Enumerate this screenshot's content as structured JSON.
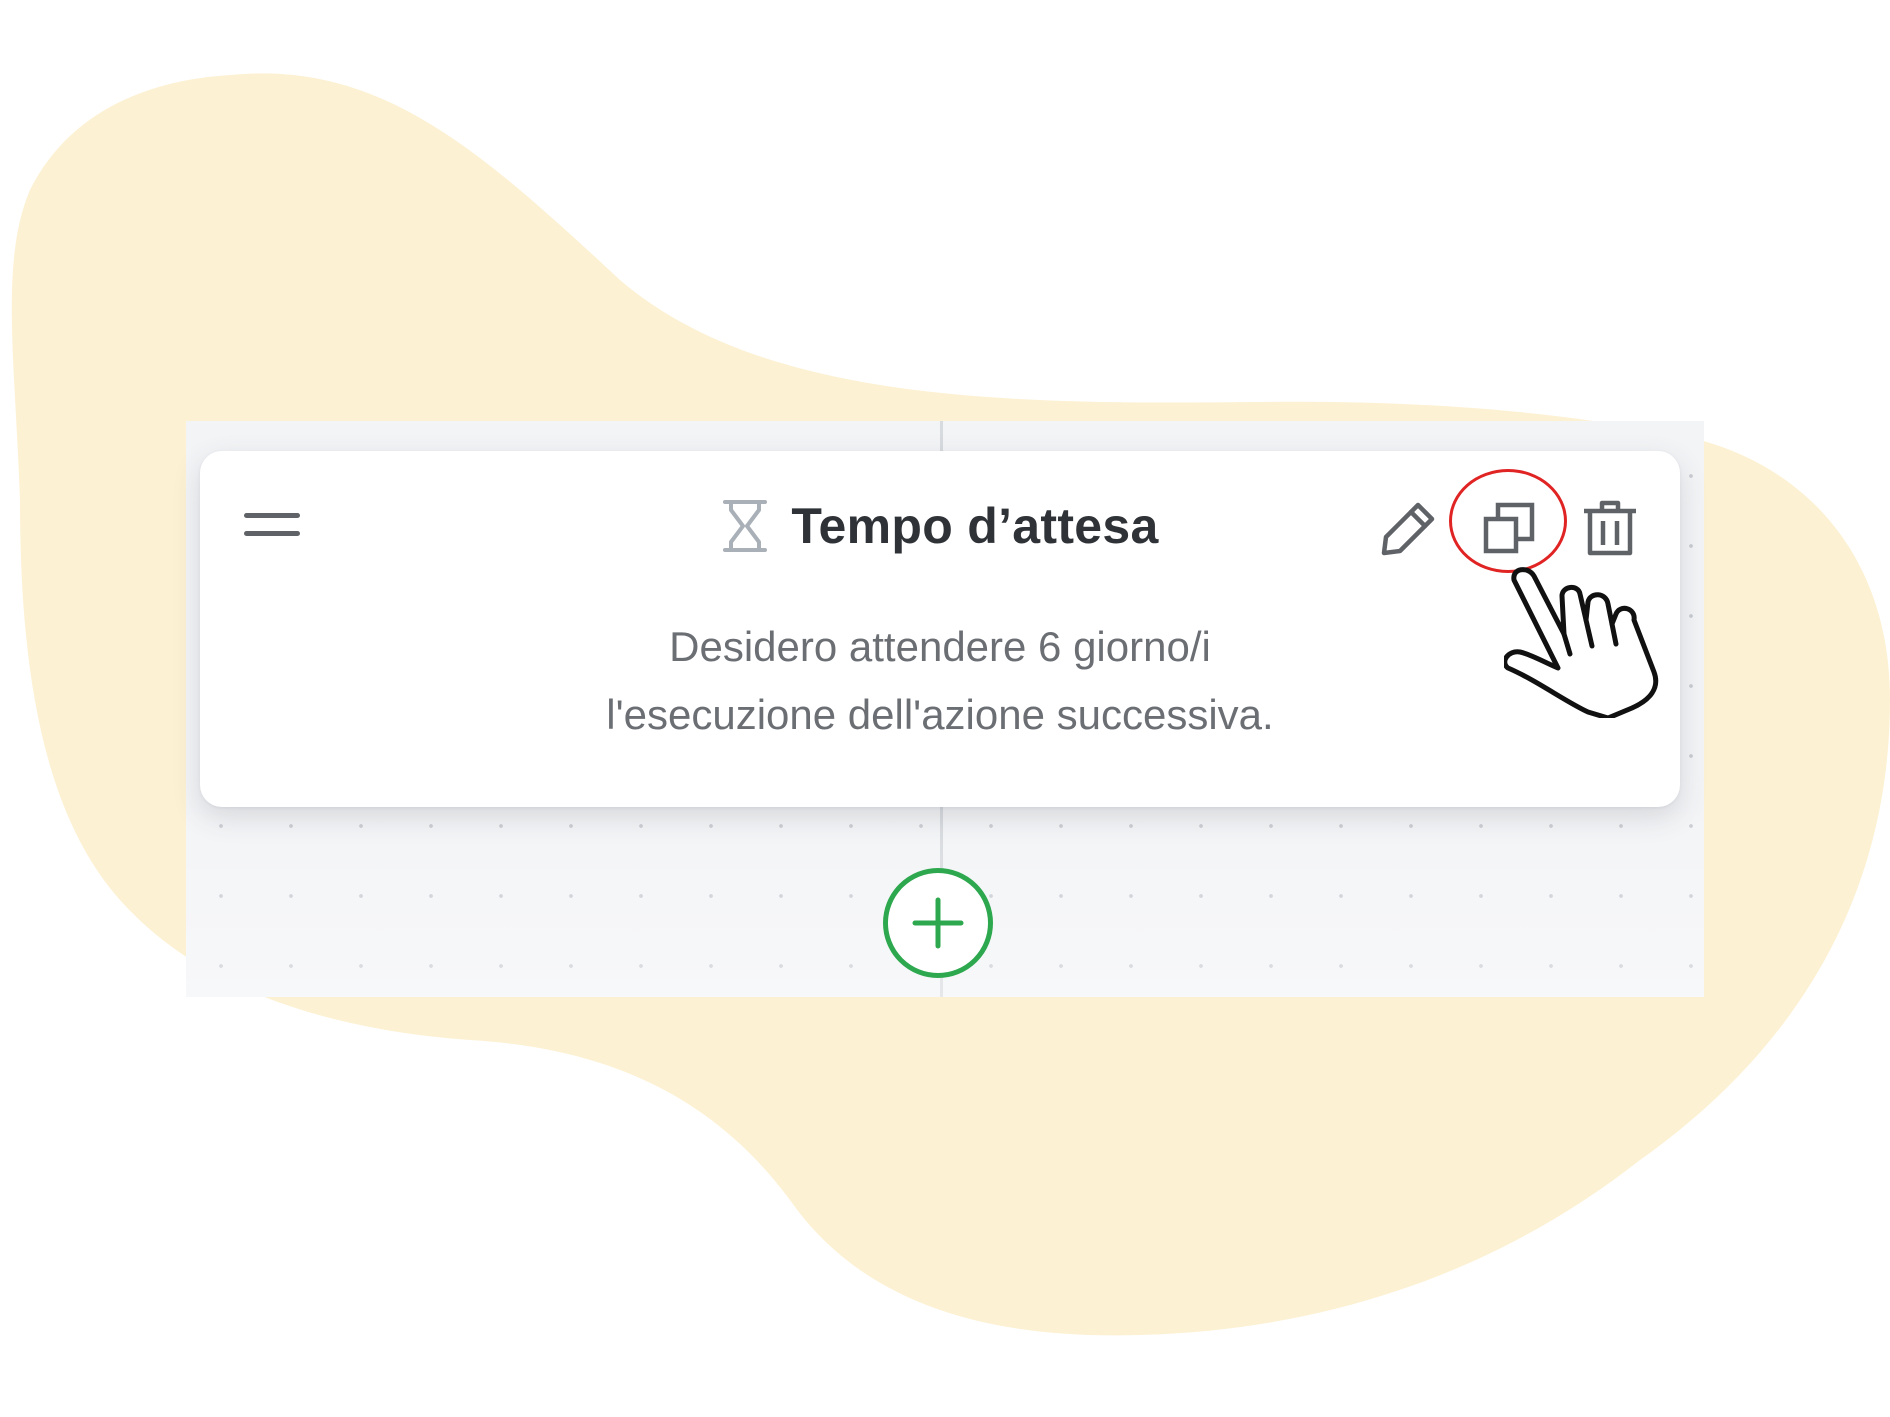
{
  "colors": {
    "background_blob": "#fdf1d3",
    "canvas": "#f3f4f6",
    "card": "#ffffff",
    "title_text": "#2f3337",
    "description_text": "#6b6f74",
    "icon_gray": "#5f6368",
    "hourglass_gray": "#aab0b7",
    "accent_green": "#2ea84f",
    "highlight_red": "#e02424"
  },
  "card": {
    "title": "Tempo d’attesa",
    "title_icon": "hourglass-icon",
    "description_line1": "Desidero attendere 6 giorno/i",
    "description_line2": "l'esecuzione dell'azione successiva.",
    "drag_handle_icon": "drag-handle-icon",
    "actions": [
      {
        "name": "edit",
        "icon": "pencil-icon"
      },
      {
        "name": "duplicate",
        "icon": "duplicate-icon",
        "highlighted": true
      },
      {
        "name": "delete",
        "icon": "trash-icon"
      }
    ]
  },
  "annotation": {
    "highlight": "red-circle-on-duplicate",
    "cursor_icon": "pointing-hand-icon"
  },
  "add_step": {
    "icon": "plus-icon"
  }
}
